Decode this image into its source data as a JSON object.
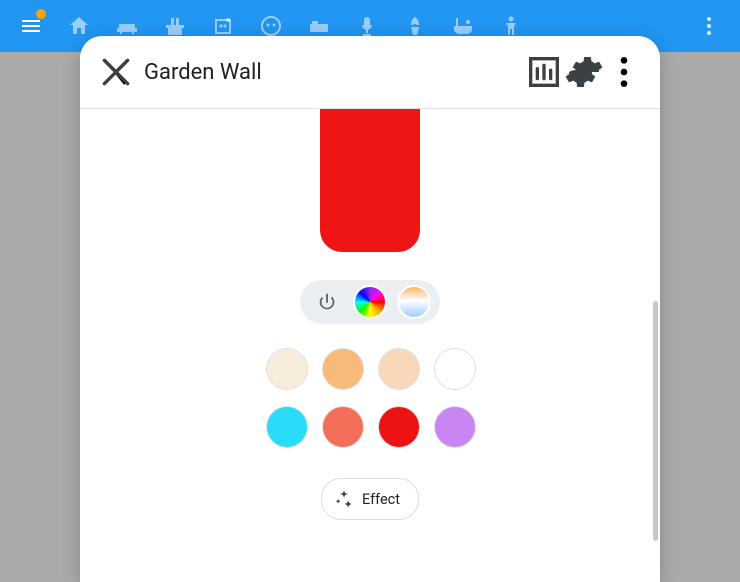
{
  "panel": {
    "title": "Garden Wall",
    "current_color": "#f01515",
    "effect_label": "Effect"
  },
  "swatches": {
    "row1": [
      "#f8ecdd",
      "#f9b97b",
      "#f9d7b9",
      "#ffffff"
    ],
    "row2": [
      "#28dcfa",
      "#f56e59",
      "#ed1313",
      "#c985f2"
    ]
  },
  "icons": {
    "menu": "menu-icon",
    "more": "more-vert-icon",
    "close": "close-icon",
    "chart": "chart-icon",
    "settings": "gear-icon",
    "power": "power-icon",
    "sparkle": "sparkle-icon"
  }
}
